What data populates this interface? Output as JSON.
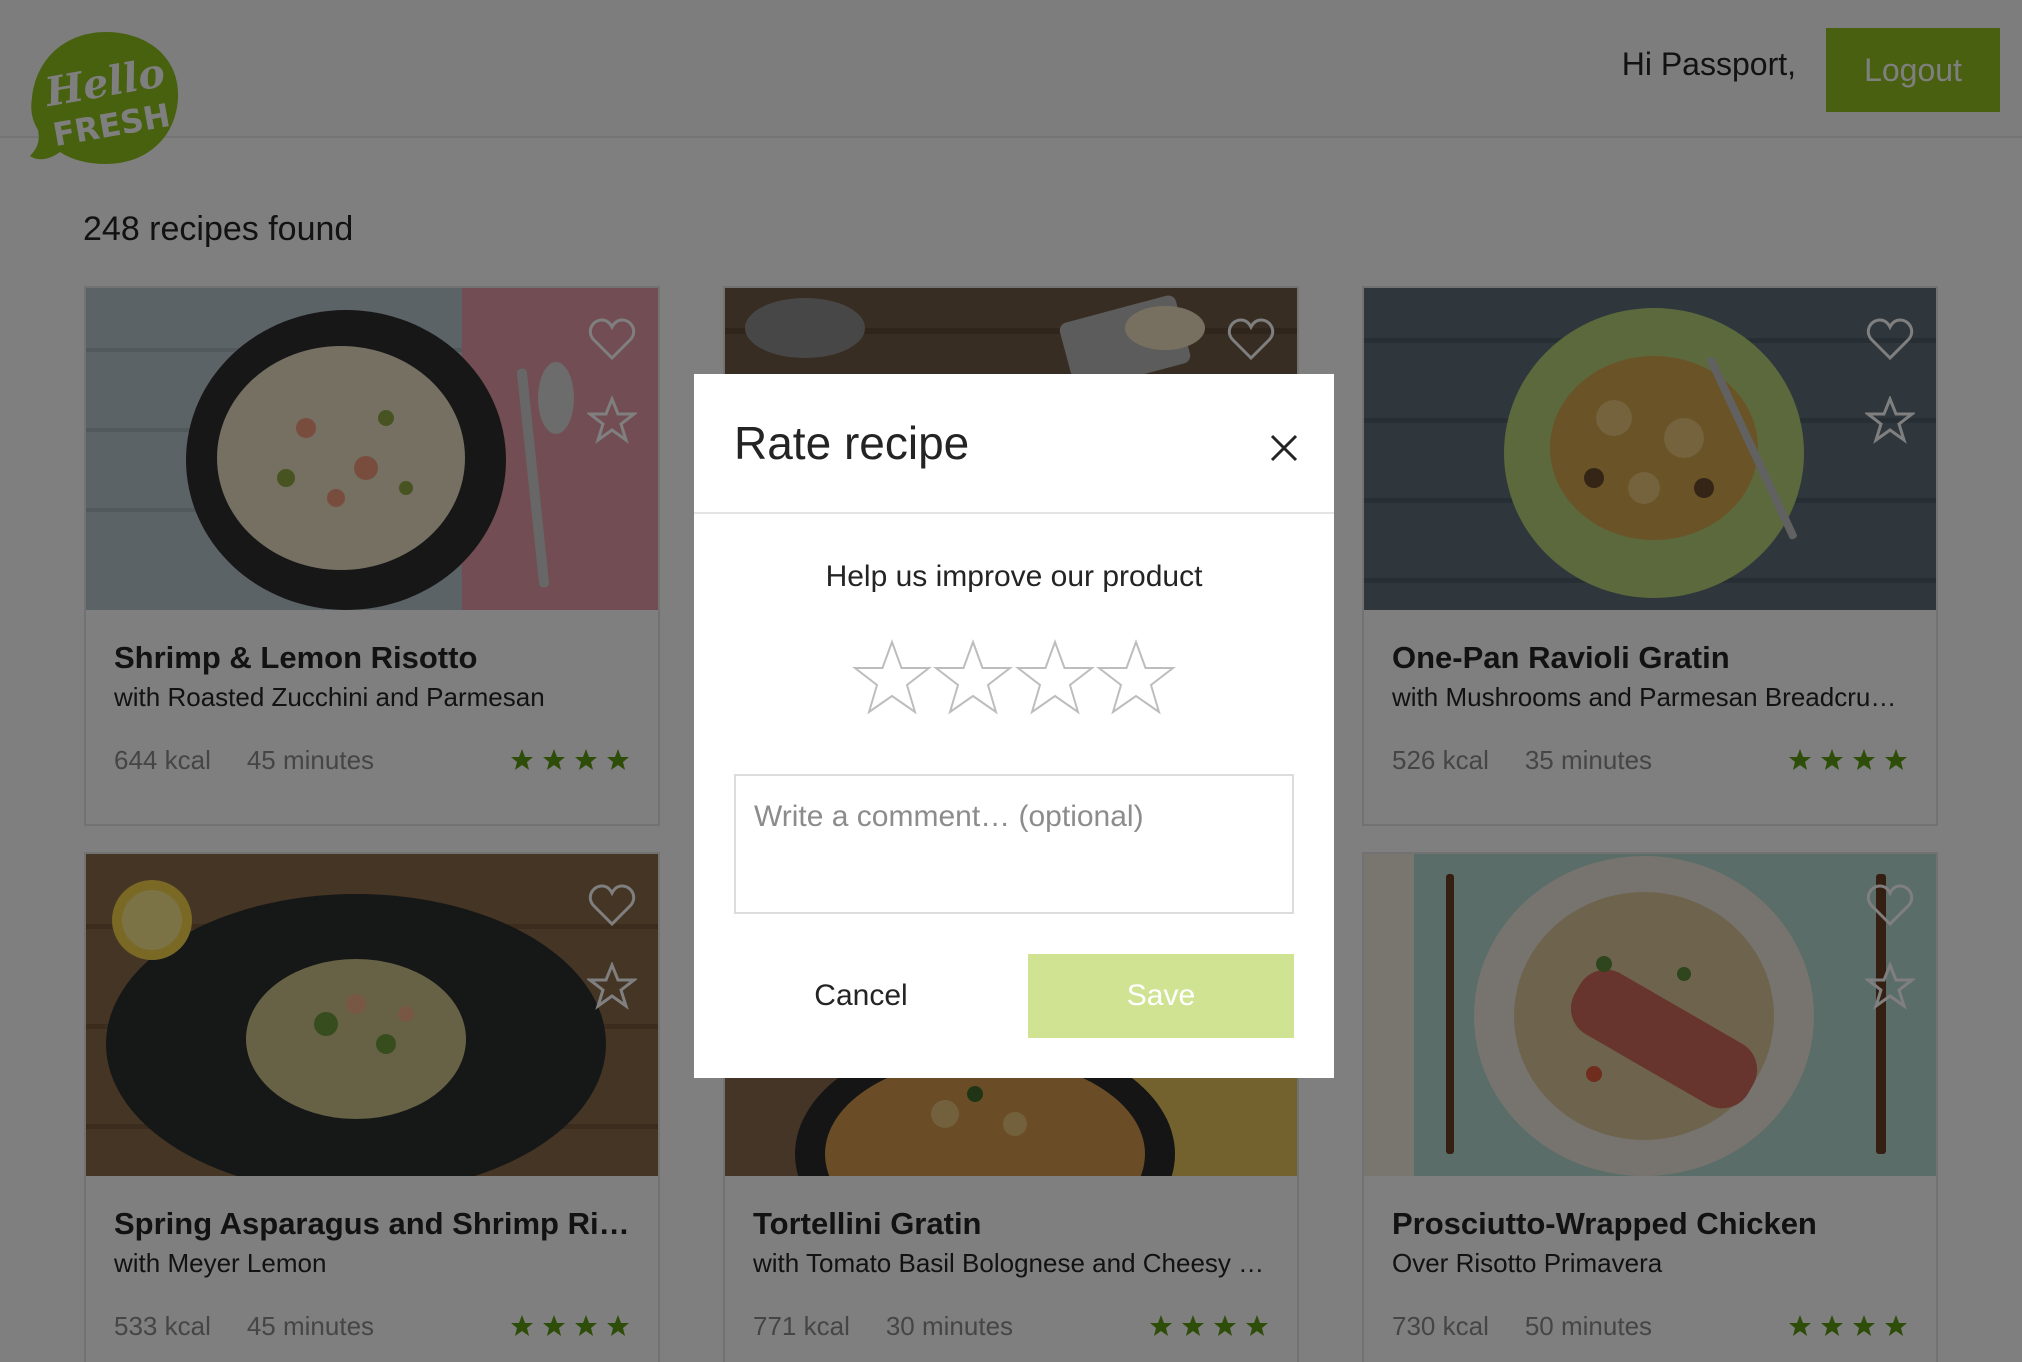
{
  "header": {
    "logo_line1": "Hello",
    "logo_line2": "FRESH",
    "greeting": "Hi Passport,",
    "logout_label": "Logout"
  },
  "results_count": "248 recipes found",
  "colors": {
    "brand_green": "#91c11e",
    "rating_star": "#5b9a12",
    "save_disabled": "#cfe392"
  },
  "recipes": [
    {
      "title": "Shrimp & Lemon Risotto",
      "subtitle": "with Roasted Zucchini and Parmesan",
      "kcal": "644 kcal",
      "time": "45 minutes",
      "rating": 4
    },
    {
      "title": "",
      "subtitle": "",
      "kcal": "",
      "time": "",
      "rating": 0
    },
    {
      "title": "One-Pan Ravioli Gratin",
      "subtitle": "with Mushrooms and Parmesan Breadcrumbs",
      "kcal": "526 kcal",
      "time": "35 minutes",
      "rating": 4
    },
    {
      "title": "Spring Asparagus and Shrimp Risotto",
      "subtitle": "with Meyer Lemon",
      "kcal": "533 kcal",
      "time": "45 minutes",
      "rating": 4
    },
    {
      "title": "Tortellini Gratin",
      "subtitle": "with Tomato Basil Bolognese and Cheesy Breadcrumbs",
      "kcal": "771 kcal",
      "time": "30 minutes",
      "rating": 4
    },
    {
      "title": "Prosciutto-Wrapped Chicken",
      "subtitle": "Over Risotto Primavera",
      "kcal": "730 kcal",
      "time": "50 minutes",
      "rating": 4
    }
  ],
  "modal": {
    "title": "Rate recipe",
    "subtitle": "Help us improve our product",
    "star_count": 4,
    "comment_placeholder": "Write a comment… (optional)",
    "comment_value": "",
    "cancel_label": "Cancel",
    "save_label": "Save"
  }
}
